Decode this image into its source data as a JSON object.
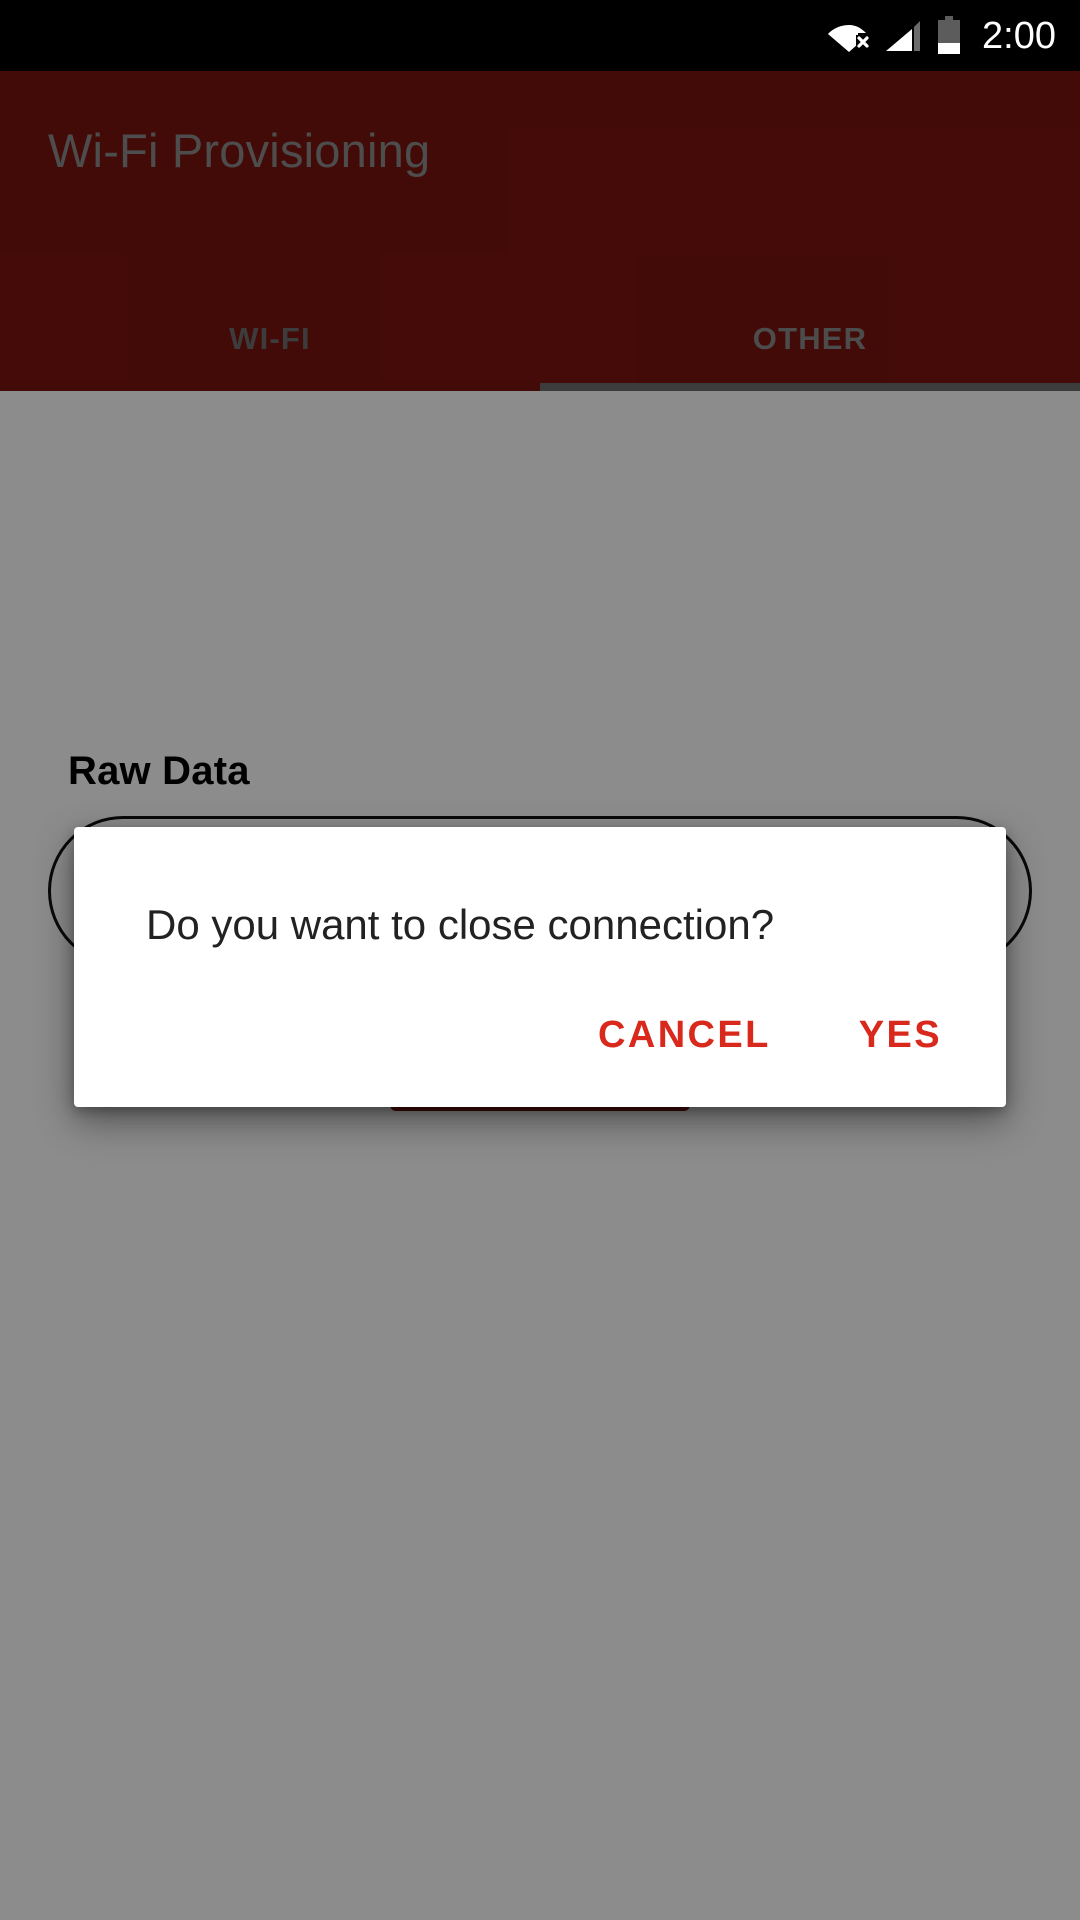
{
  "status_bar": {
    "time": "2:00",
    "icons": [
      {
        "name": "wifi-off-icon",
        "label": "Wi-Fi disconnected"
      },
      {
        "name": "cellular-signal-icon",
        "label": "Cellular signal"
      },
      {
        "name": "battery-icon",
        "label": "Battery low"
      }
    ],
    "background_color": "#000000",
    "foreground_color": "#ffffff"
  },
  "app_bar": {
    "title": "Wi-Fi Provisioning",
    "background_color": "#7b1410",
    "title_color": "#8d8d8d"
  },
  "tabs": [
    {
      "label": "WI-FI",
      "selected": false
    },
    {
      "label": "OTHER",
      "selected": true
    }
  ],
  "content": {
    "raw_data_label": "Raw Data",
    "raw_data_value": "",
    "raw_data_placeholder": "",
    "send_button_label": "",
    "accent_color": "#7b1410"
  },
  "dialog": {
    "message": "Do you want to close connection?",
    "cancel_label": "CANCEL",
    "confirm_label": "YES",
    "action_color": "#d8291c",
    "background_color": "#ffffff"
  },
  "scrim": {
    "color": "rgba(0,0,0,0.45)"
  }
}
